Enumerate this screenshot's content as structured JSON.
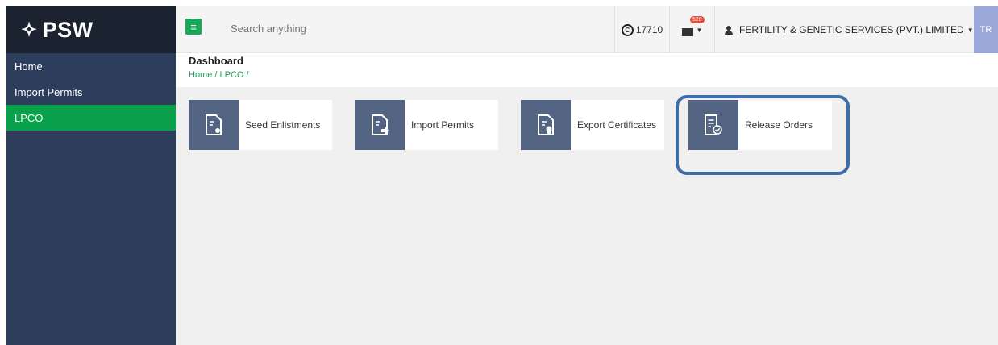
{
  "brand": {
    "logo_text": "PSW"
  },
  "sidebar": {
    "items": [
      {
        "label": "Home",
        "active": false
      },
      {
        "label": "Import Permits",
        "active": false
      },
      {
        "label": "LPCO",
        "active": true
      }
    ]
  },
  "topbar": {
    "search_placeholder": "Search anything",
    "coins_value": "17710",
    "mail_badge": "520",
    "user_name": "FERTILITY & GENETIC SERVICES (PVT.) LIMITED",
    "avatar_initials": "TR"
  },
  "page": {
    "title": "Dashboard",
    "breadcrumb": "Home / LPCO /"
  },
  "cards": [
    {
      "label": "Seed Enlistments",
      "icon": "document-seed-icon"
    },
    {
      "label": "Import Permits",
      "icon": "document-import-icon"
    },
    {
      "label": "Export Certificates",
      "icon": "document-certificate-icon"
    },
    {
      "label": "Release Orders",
      "icon": "document-check-icon",
      "highlighted": true
    }
  ],
  "colors": {
    "sidebar": "#2c3e5c",
    "active": "#0aa14d",
    "card_icon_bg": "#526482",
    "highlight": "#3e6da8"
  }
}
